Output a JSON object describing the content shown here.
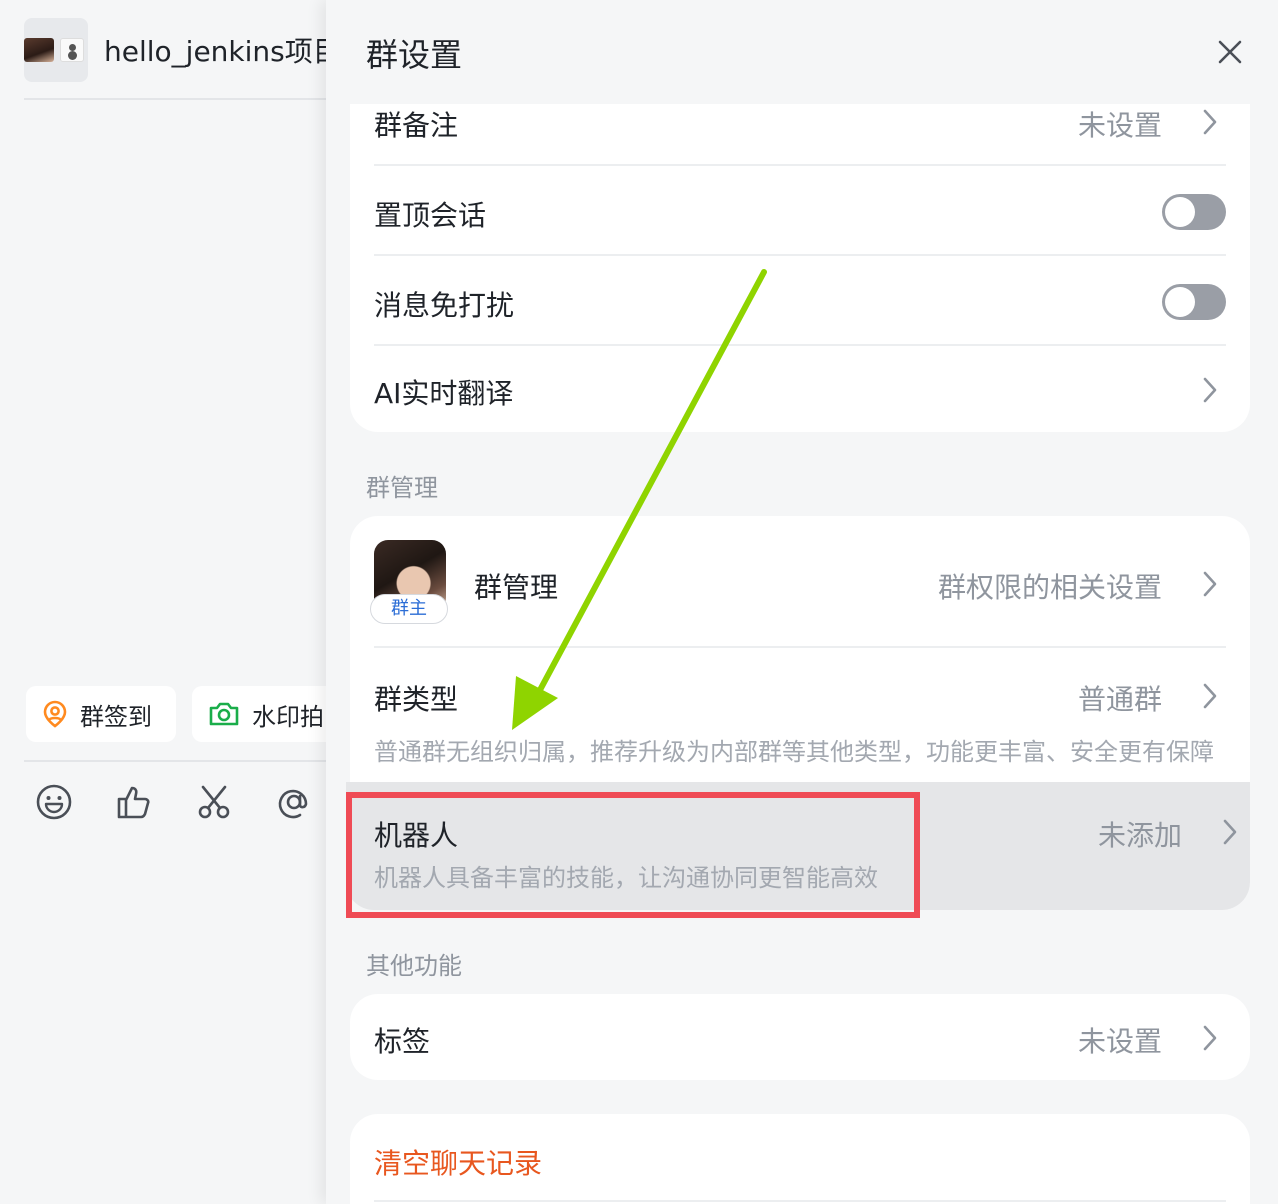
{
  "chat": {
    "title": "hello_jenkins项目",
    "quick_actions": [
      {
        "label": "群签到",
        "icon": "location-pin-icon"
      },
      {
        "label": "水印拍",
        "icon": "camera-icon"
      }
    ],
    "toolbar_icons": [
      "emoji-icon",
      "thumbs-up-icon",
      "scissors-icon",
      "at-icon"
    ]
  },
  "settings": {
    "title": "群设置",
    "close_icon": "close-icon",
    "basic": [
      {
        "label": "群备注",
        "value": "未设置",
        "type": "link"
      },
      {
        "label": "置顶会话",
        "type": "toggle",
        "on": false
      },
      {
        "label": "消息免打扰",
        "type": "toggle",
        "on": false
      },
      {
        "label": "AI实时翻译",
        "type": "link"
      }
    ],
    "group_mgmt": {
      "section_title": "群管理",
      "manage": {
        "label": "群管理",
        "badge": "群主",
        "value": "群权限的相关设置"
      },
      "type": {
        "label": "群类型",
        "value": "普通群",
        "desc": "普通群无组织归属，推荐升级为内部群等其他类型，功能更丰富、安全更有保障"
      },
      "robot": {
        "label": "机器人",
        "value": "未添加",
        "desc": "机器人具备丰富的技能，让沟通协同更智能高效"
      }
    },
    "other": {
      "section_title": "其他功能",
      "tag": {
        "label": "标签",
        "value": "未设置"
      }
    },
    "danger": {
      "label": "清空聊天记录"
    }
  },
  "colors": {
    "accent_green": "#8fd400",
    "highlight_red": "#ef4b55",
    "danger_orange": "#e8571f",
    "pin_orange": "#ff8a1f",
    "camera_green": "#1aad4a"
  }
}
